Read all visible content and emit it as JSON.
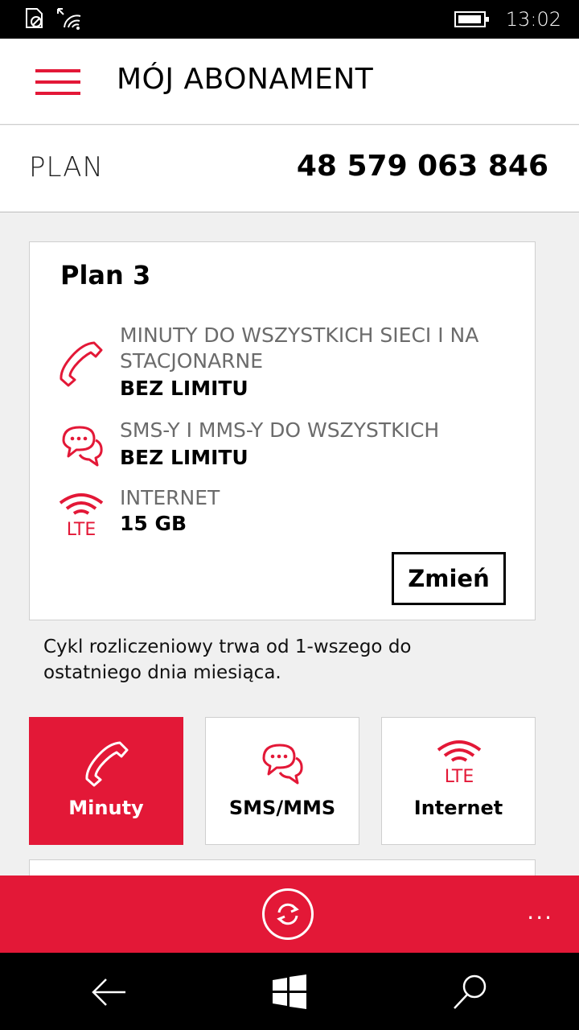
{
  "status": {
    "time": "13:02"
  },
  "header": {
    "title": "MÓJ ABONAMENT"
  },
  "plan_row": {
    "label": "PLAN",
    "number": "48 579 063 846"
  },
  "card": {
    "title": "Plan 3",
    "features": [
      {
        "icon": "phone-icon",
        "name": "MINUTY DO WSZYSTKICH SIECI I NA STACJONARNE",
        "value": "BEZ LIMITU"
      },
      {
        "icon": "chat-icon",
        "name": "SMS-Y I MMS-Y DO WSZYSTKICH",
        "value": "BEZ LIMITU"
      },
      {
        "icon": "lte-icon",
        "name": "INTERNET",
        "value": "15 GB",
        "icon_text": "LTE"
      }
    ],
    "change_label": "Zmień"
  },
  "cycle_note": "Cykl rozliczeniowy trwa od 1-wszego do ostatniego dnia miesiąca.",
  "tiles": [
    {
      "icon": "phone-icon",
      "label": "Minuty",
      "active": true
    },
    {
      "icon": "chat-icon",
      "label": "SMS/MMS",
      "active": false
    },
    {
      "icon": "lte-icon",
      "label": "Internet",
      "active": false,
      "icon_text": "LTE"
    }
  ],
  "appbar": {
    "more_label": "..."
  },
  "colors": {
    "accent": "#e31837",
    "background": "#f0f0f0"
  }
}
